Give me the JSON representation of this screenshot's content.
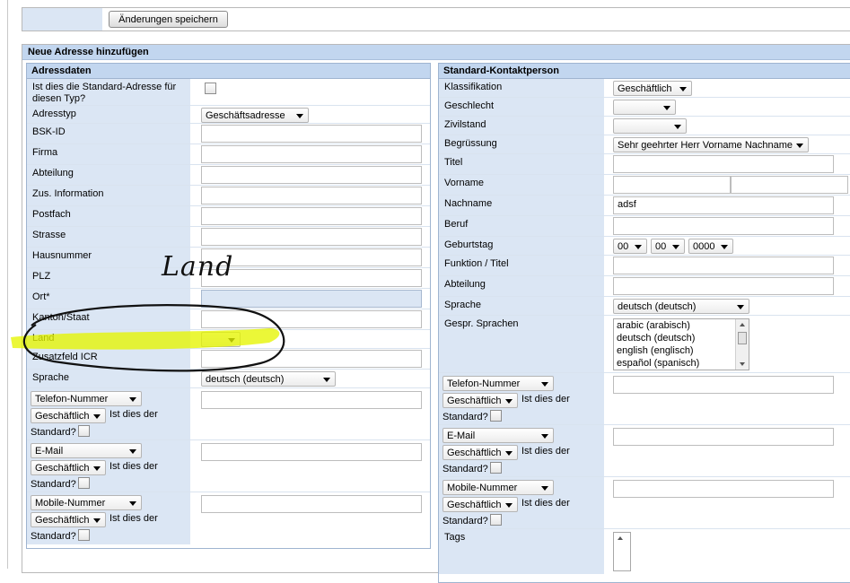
{
  "toolbar": {
    "save_label": "Änderungen speichern"
  },
  "section_title": "Neue Adresse hinzufügen",
  "address": {
    "title": "Adressdaten",
    "std_label": "Ist dies die Standard-Adresse für diesen Typ?",
    "adresstyp_label": "Adresstyp",
    "adresstyp_value": "Geschäftsadresse",
    "bsk_label": "BSK-ID",
    "firma_label": "Firma",
    "abteilung_label": "Abteilung",
    "zus_label": "Zus. Information",
    "postfach_label": "Postfach",
    "strasse_label": "Strasse",
    "hausnummer_label": "Hausnummer",
    "plz_label": "PLZ",
    "ort_label": "Ort*",
    "kanton_label": "Kanton/Staat",
    "land_label": "Land",
    "land_value": "",
    "zusatzfeld_label": "Zusatzfeld ICR",
    "sprache_label": "Sprache",
    "sprache_value": "deutsch (deutsch)",
    "contacts": [
      {
        "type": "Telefon-Nummer",
        "kind": "Geschäftlich"
      },
      {
        "type": "E-Mail",
        "kind": "Geschäftlich"
      },
      {
        "type": "Mobile-Nummer",
        "kind": "Geschäftlich"
      }
    ]
  },
  "contact_person": {
    "title": "Standard-Kontaktperson",
    "klassifikation_label": "Klassifikation",
    "klassifikation_value": "Geschäftlich",
    "geschlecht_label": "Geschlecht",
    "geschlecht_value": "",
    "zivilstand_label": "Zivilstand",
    "zivilstand_value": "",
    "begruessung_label": "Begrüssung",
    "begruessung_value": "Sehr geehrter Herr Vorname Nachname",
    "titel_label": "Titel",
    "vorname_label": "Vorname",
    "nachname_label": "Nachname",
    "nachname_value": "adsf",
    "beruf_label": "Beruf",
    "geburtstag_label": "Geburtstag",
    "geburtstag_day": "00",
    "geburtstag_month": "00",
    "geburtstag_year": "0000",
    "funktion_label": "Funktion / Titel",
    "abteilung_label": "Abteilung",
    "sprache_label": "Sprache",
    "sprache_value": "deutsch (deutsch)",
    "gespr_label": "Gespr. Sprachen",
    "gespr_options": [
      "arabic (arabisch)",
      "deutsch (deutsch)",
      "english (englisch)",
      "español (spanisch)"
    ],
    "contacts": [
      {
        "type": "Telefon-Nummer",
        "kind": "Geschäftlich"
      },
      {
        "type": "E-Mail",
        "kind": "Geschäftlich"
      },
      {
        "type": "Mobile-Nummer",
        "kind": "Geschäftlich"
      }
    ],
    "tags_label": "Tags"
  },
  "standard_text_1": "Ist dies der",
  "standard_text_2": "Standard?",
  "annotation": {
    "text": "Land",
    "highlight_color": "#e6f500"
  }
}
